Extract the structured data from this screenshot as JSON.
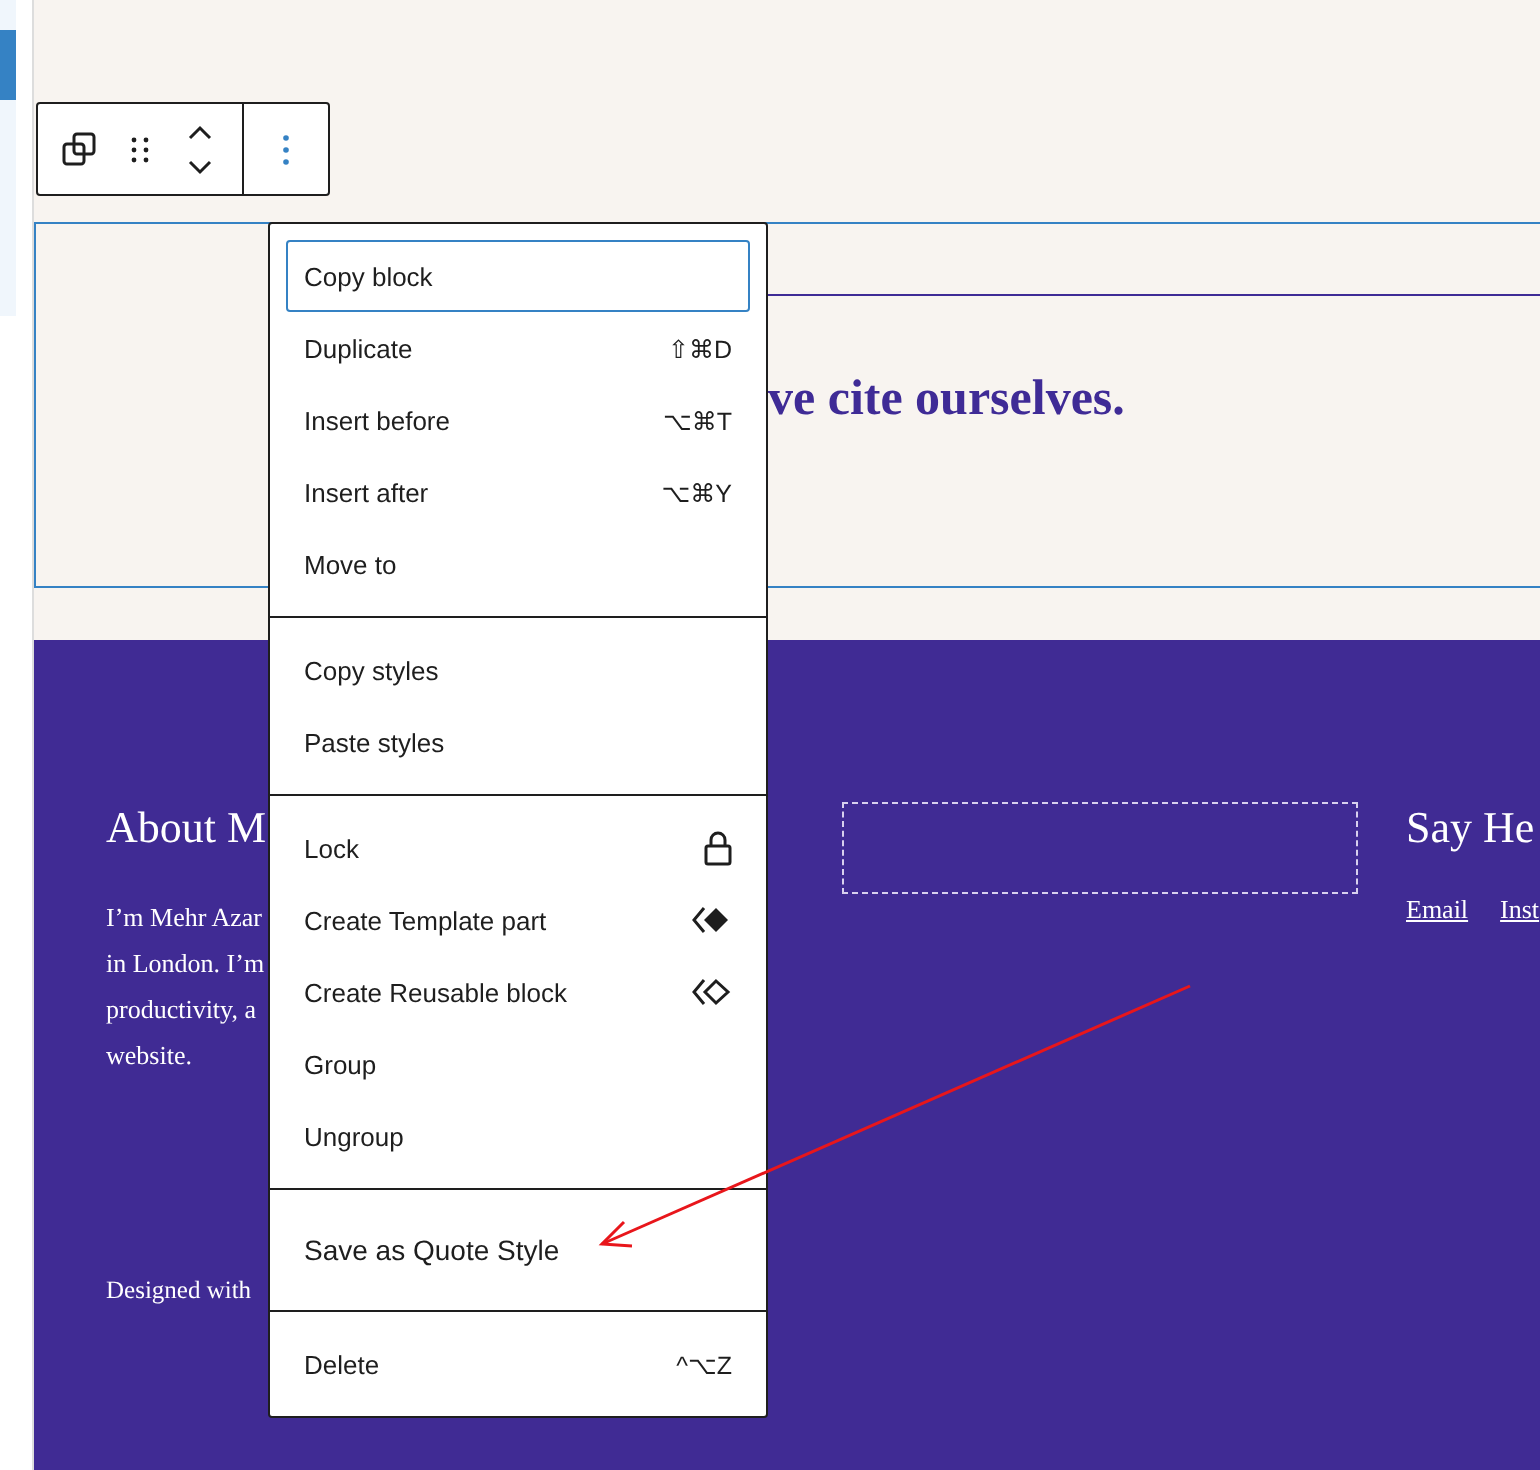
{
  "toolbar": {
    "buttons": [
      {
        "kind": "transform"
      },
      {
        "kind": "drag"
      },
      {
        "kind": "move"
      },
      {
        "kind": "options"
      }
    ]
  },
  "quote": {
    "text": "ve cite ourselves."
  },
  "footer": {
    "about": {
      "heading": "About M",
      "lines": [
        "I’m Mehr Azar",
        "in London. I’m",
        "productivity, a",
        "website."
      ]
    },
    "credit": "Designed with",
    "contact": {
      "heading": "Say He",
      "links": [
        "Email",
        "Inst"
      ]
    }
  },
  "menu": {
    "groups": [
      {
        "items": [
          {
            "label": "Copy block",
            "focused": true
          },
          {
            "label": "Duplicate",
            "shortcut": "⇧⌘D",
            "focused": false
          },
          {
            "label": "Insert before",
            "shortcut": "⌥⌘T",
            "focused": false
          },
          {
            "label": "Insert after",
            "shortcut": "⌥⌘Y",
            "focused": false
          },
          {
            "label": "Move to",
            "focused": false
          }
        ]
      },
      {
        "items": [
          {
            "label": "Copy styles",
            "focused": false
          },
          {
            "label": "Paste styles",
            "focused": false
          }
        ]
      },
      {
        "items": [
          {
            "label": "Lock",
            "kind": "lock",
            "focused": false
          },
          {
            "label": "Create Template part",
            "kind": "template-part",
            "focused": false
          },
          {
            "label": "Create Reusable block",
            "kind": "reusable",
            "focused": false
          },
          {
            "label": "Group",
            "focused": false
          },
          {
            "label": "Ungroup",
            "focused": false
          }
        ]
      },
      {
        "items": [
          {
            "label": "Save as Quote Style",
            "focused": false
          }
        ]
      },
      {
        "items": [
          {
            "label": "Delete",
            "shortcut": "^⌥Z",
            "focused": false
          }
        ]
      }
    ]
  }
}
